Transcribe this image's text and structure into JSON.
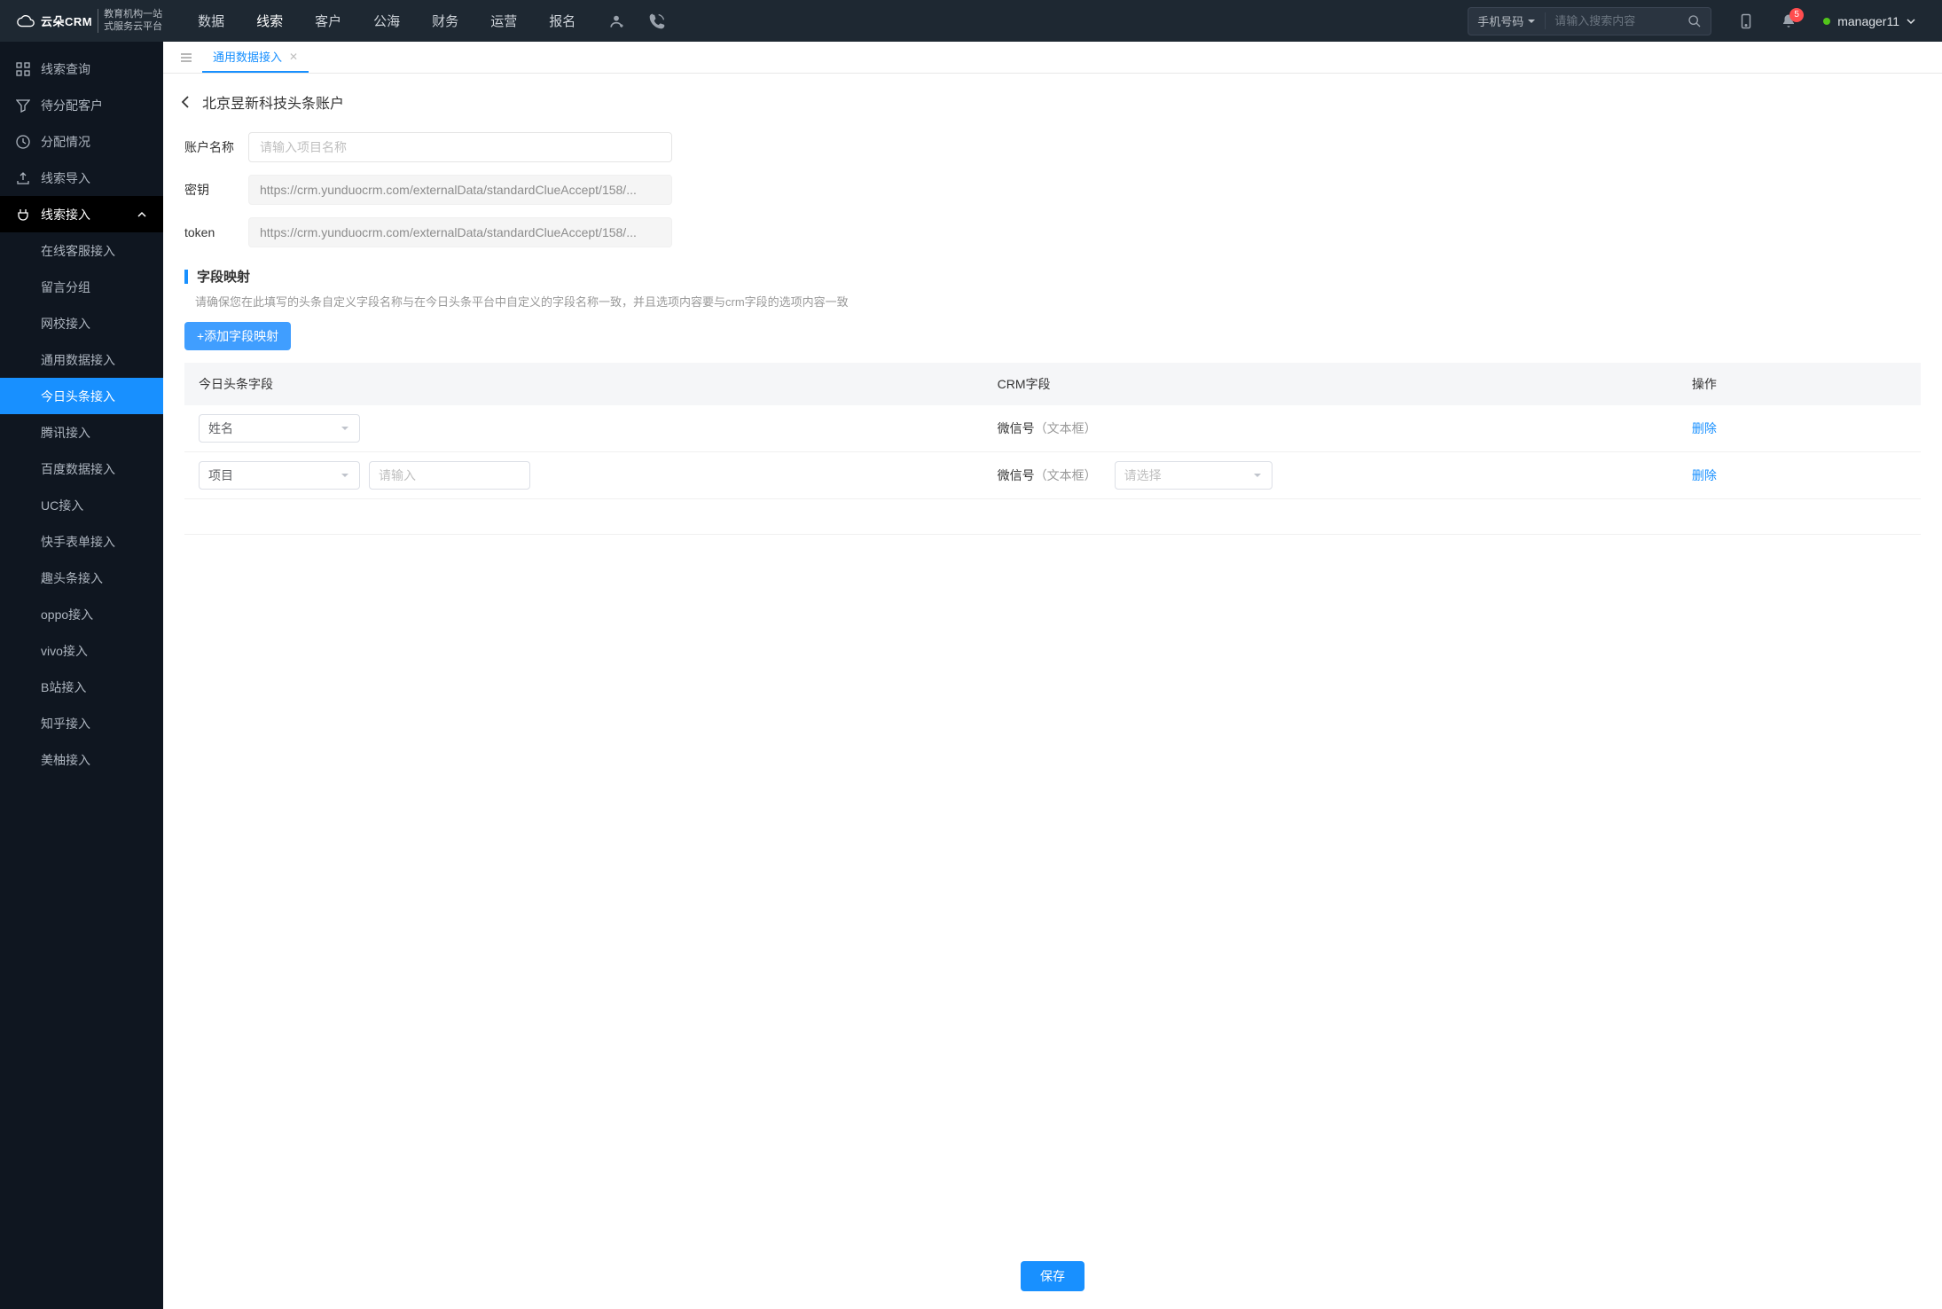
{
  "brand": {
    "name": "云朵CRM",
    "domain": "www.yunduocrm.com",
    "tagline1": "教育机构一站",
    "tagline2": "式服务云平台"
  },
  "topnav": {
    "items": [
      "数据",
      "线索",
      "客户",
      "公海",
      "财务",
      "运营",
      "报名"
    ],
    "active_index": 1,
    "search_type": "手机号码",
    "search_placeholder": "请输入搜索内容",
    "notif_count": "5",
    "username": "manager11"
  },
  "sidebar": {
    "items": [
      {
        "label": "线索查询",
        "icon": "grid"
      },
      {
        "label": "待分配客户",
        "icon": "filter"
      },
      {
        "label": "分配情况",
        "icon": "clock"
      },
      {
        "label": "线索导入",
        "icon": "upload"
      },
      {
        "label": "线索接入",
        "icon": "plug",
        "expanded": true,
        "children": [
          {
            "label": "在线客服接入"
          },
          {
            "label": "留言分组"
          },
          {
            "label": "网校接入"
          },
          {
            "label": "通用数据接入"
          },
          {
            "label": "今日头条接入",
            "active": true
          },
          {
            "label": "腾讯接入"
          },
          {
            "label": "百度数据接入"
          },
          {
            "label": "UC接入"
          },
          {
            "label": "快手表单接入"
          },
          {
            "label": "趣头条接入"
          },
          {
            "label": "oppo接入"
          },
          {
            "label": "vivo接入"
          },
          {
            "label": "B站接入"
          },
          {
            "label": "知乎接入"
          },
          {
            "label": "美柚接入"
          }
        ]
      }
    ]
  },
  "tabs": {
    "active": "通用数据接入"
  },
  "page": {
    "title": "北京昱新科技头条账户",
    "account_name_label": "账户名称",
    "account_name_placeholder": "请输入项目名称",
    "secret_label": "密钥",
    "secret_value": "https://crm.yunduocrm.com/externalData/standardClueAccept/158/...",
    "token_label": "token",
    "token_value": "https://crm.yunduocrm.com/externalData/standardClueAccept/158/...",
    "mapping_title": "字段映射",
    "mapping_desc": "请确保您在此填写的头条自定义字段名称与在今日头条平台中自定义的字段名称一致，并且选项内容要与crm字段的选项内容一致",
    "add_mapping_btn": "+添加字段映射",
    "table": {
      "cols": [
        "今日头条字段",
        "CRM字段",
        "操作"
      ],
      "rows": [
        {
          "field": "姓名",
          "extra_input": null,
          "crm_field": "微信号",
          "crm_hint": "（文本框）",
          "crm_select": null,
          "delete": "删除"
        },
        {
          "field": "项目",
          "extra_input_placeholder": "请输入",
          "crm_field": "微信号",
          "crm_hint": "（文本框）",
          "crm_select_placeholder": "请选择",
          "delete": "删除"
        }
      ]
    },
    "save_btn": "保存"
  }
}
